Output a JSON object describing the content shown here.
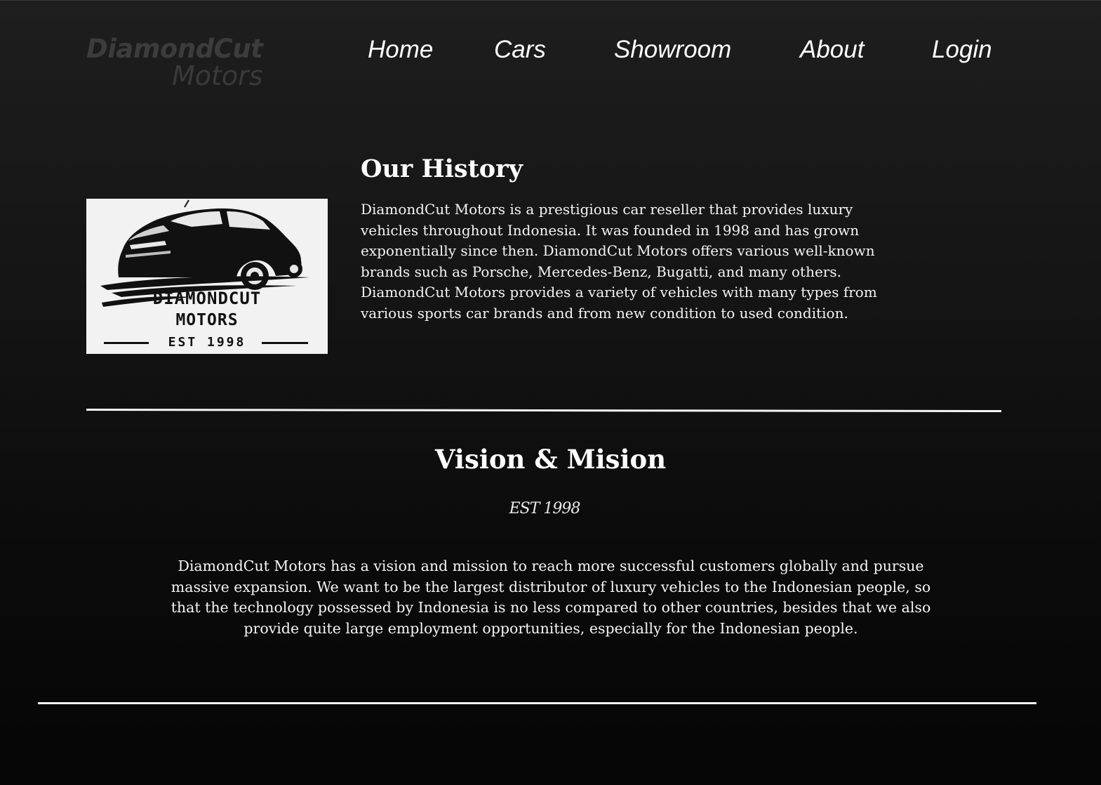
{
  "header": {
    "brand_main": "DiamondCut",
    "brand_sub": "Motors",
    "nav": [
      {
        "label": "Home"
      },
      {
        "label": "Cars"
      },
      {
        "label": "Showroom"
      },
      {
        "label": "About"
      },
      {
        "label": "Login"
      }
    ]
  },
  "history": {
    "title": "Our History",
    "logo": {
      "line1": "DIAMONDCUT",
      "line2": "MOTORS",
      "line3": "EST 1998"
    },
    "body": "DiamondCut Motors is a prestigious car reseller that provides luxury vehicles throughout Indonesia. It was founded in 1998 and has grown exponentially since then. DiamondCut Motors offers various well-known brands such as Porsche, Mercedes-Benz, Bugatti, and many others. DiamondCut Motors provides a variety of vehicles with many types from various sports car brands and from new condition to used condition."
  },
  "vision": {
    "title": "Vision & Mision",
    "tag": "EST 1998",
    "body": "DiamondCut Motors has a vision and mission to reach more successful customers globally and pursue massive expansion. We want to be the largest distributor of luxury vehicles to the Indonesian people, so that the technology possessed by Indonesia is no less compared to other countries, besides that we also provide quite large employment opportunities, especially for the Indonesian people."
  },
  "colors": {
    "background_top": "#1e1e1e",
    "background_bottom": "#050505",
    "text": "#ffffff",
    "brand_muted": "#3c3c3c",
    "logo_card": "#f2f2f2"
  }
}
